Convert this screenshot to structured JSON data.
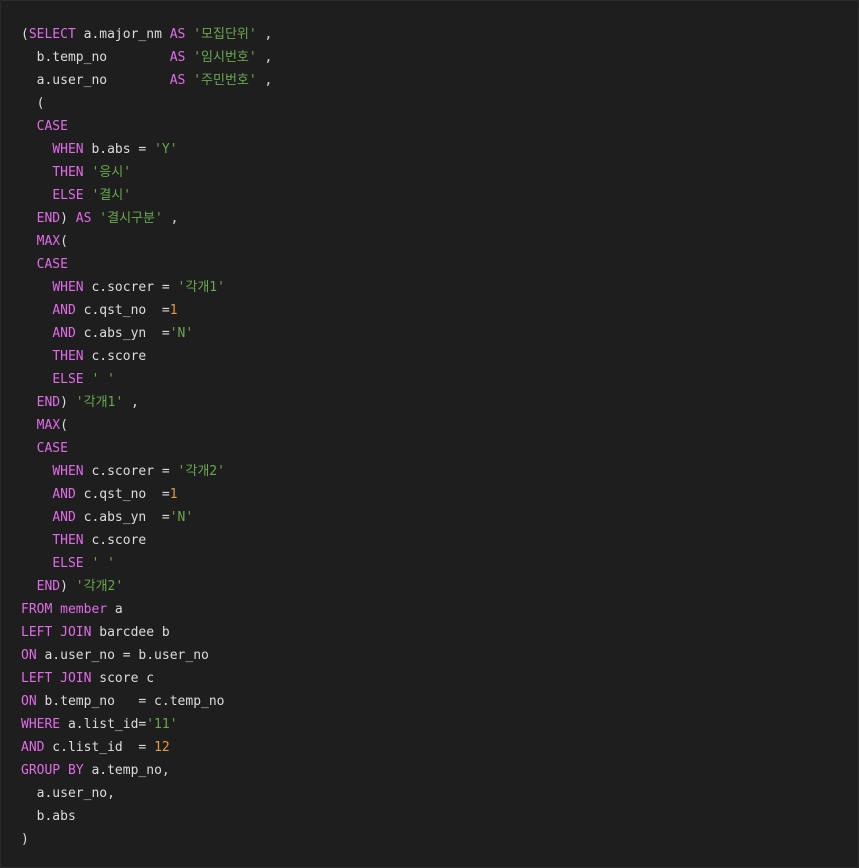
{
  "editor": {
    "language": "sql",
    "colors": {
      "background": "#1e1e1e",
      "keyword": "#e06ce8",
      "string": "#6aa84f",
      "number": "#e59b3f",
      "text": "#dcdcdc"
    },
    "lines": [
      [
        {
          "t": "pun",
          "v": "("
        },
        {
          "t": "kw",
          "v": "SELECT"
        },
        {
          "t": "id",
          "v": " a.major_nm "
        },
        {
          "t": "kw",
          "v": "AS"
        },
        {
          "t": "id",
          "v": " "
        },
        {
          "t": "str",
          "v": "'모집단위'"
        },
        {
          "t": "pun",
          "v": " ,"
        }
      ],
      [
        {
          "t": "id",
          "v": "  b.temp_no        "
        },
        {
          "t": "kw",
          "v": "AS"
        },
        {
          "t": "id",
          "v": " "
        },
        {
          "t": "str",
          "v": "'임시번호'"
        },
        {
          "t": "pun",
          "v": " ,"
        }
      ],
      [
        {
          "t": "id",
          "v": "  a.user_no        "
        },
        {
          "t": "kw",
          "v": "AS"
        },
        {
          "t": "id",
          "v": " "
        },
        {
          "t": "str",
          "v": "'주민번호'"
        },
        {
          "t": "pun",
          "v": " ,"
        }
      ],
      [
        {
          "t": "pun",
          "v": "  ("
        }
      ],
      [
        {
          "t": "id",
          "v": "  "
        },
        {
          "t": "kw",
          "v": "CASE"
        }
      ],
      [
        {
          "t": "id",
          "v": "    "
        },
        {
          "t": "kw",
          "v": "WHEN"
        },
        {
          "t": "id",
          "v": " b.abs = "
        },
        {
          "t": "str",
          "v": "'Y'"
        }
      ],
      [
        {
          "t": "id",
          "v": "    "
        },
        {
          "t": "kw",
          "v": "THEN"
        },
        {
          "t": "id",
          "v": " "
        },
        {
          "t": "str",
          "v": "'응시'"
        }
      ],
      [
        {
          "t": "id",
          "v": "    "
        },
        {
          "t": "kw",
          "v": "ELSE"
        },
        {
          "t": "id",
          "v": " "
        },
        {
          "t": "str",
          "v": "'결시'"
        }
      ],
      [
        {
          "t": "id",
          "v": "  "
        },
        {
          "t": "kw",
          "v": "END"
        },
        {
          "t": "pun",
          "v": ") "
        },
        {
          "t": "kw",
          "v": "AS"
        },
        {
          "t": "id",
          "v": " "
        },
        {
          "t": "str",
          "v": "'결시구분'"
        },
        {
          "t": "pun",
          "v": " ,"
        }
      ],
      [
        {
          "t": "id",
          "v": "  "
        },
        {
          "t": "kw",
          "v": "MAX"
        },
        {
          "t": "pun",
          "v": "("
        }
      ],
      [
        {
          "t": "id",
          "v": "  "
        },
        {
          "t": "kw",
          "v": "CASE"
        }
      ],
      [
        {
          "t": "id",
          "v": "    "
        },
        {
          "t": "kw",
          "v": "WHEN"
        },
        {
          "t": "id",
          "v": " c.socrer = "
        },
        {
          "t": "str",
          "v": "'각개1'"
        }
      ],
      [
        {
          "t": "id",
          "v": "    "
        },
        {
          "t": "kw",
          "v": "AND"
        },
        {
          "t": "id",
          "v": " c.qst_no  ="
        },
        {
          "t": "num",
          "v": "1"
        }
      ],
      [
        {
          "t": "id",
          "v": "    "
        },
        {
          "t": "kw",
          "v": "AND"
        },
        {
          "t": "id",
          "v": " c.abs_yn  ="
        },
        {
          "t": "str",
          "v": "'N'"
        }
      ],
      [
        {
          "t": "id",
          "v": "    "
        },
        {
          "t": "kw",
          "v": "THEN"
        },
        {
          "t": "id",
          "v": " c.score"
        }
      ],
      [
        {
          "t": "id",
          "v": "    "
        },
        {
          "t": "kw",
          "v": "ELSE"
        },
        {
          "t": "id",
          "v": " "
        },
        {
          "t": "str",
          "v": "' '"
        }
      ],
      [
        {
          "t": "id",
          "v": "  "
        },
        {
          "t": "kw",
          "v": "END"
        },
        {
          "t": "pun",
          "v": ") "
        },
        {
          "t": "str",
          "v": "'각개1'"
        },
        {
          "t": "pun",
          "v": " ,"
        }
      ],
      [
        {
          "t": "id",
          "v": "  "
        },
        {
          "t": "kw",
          "v": "MAX"
        },
        {
          "t": "pun",
          "v": "("
        }
      ],
      [
        {
          "t": "id",
          "v": "  "
        },
        {
          "t": "kw",
          "v": "CASE"
        }
      ],
      [
        {
          "t": "id",
          "v": "    "
        },
        {
          "t": "kw",
          "v": "WHEN"
        },
        {
          "t": "id",
          "v": " c.scorer = "
        },
        {
          "t": "str",
          "v": "'각개2'"
        }
      ],
      [
        {
          "t": "id",
          "v": "    "
        },
        {
          "t": "kw",
          "v": "AND"
        },
        {
          "t": "id",
          "v": " c.qst_no  ="
        },
        {
          "t": "num",
          "v": "1"
        }
      ],
      [
        {
          "t": "id",
          "v": "    "
        },
        {
          "t": "kw",
          "v": "AND"
        },
        {
          "t": "id",
          "v": " c.abs_yn  ="
        },
        {
          "t": "str",
          "v": "'N'"
        }
      ],
      [
        {
          "t": "id",
          "v": "    "
        },
        {
          "t": "kw",
          "v": "THEN"
        },
        {
          "t": "id",
          "v": " c.score"
        }
      ],
      [
        {
          "t": "id",
          "v": "    "
        },
        {
          "t": "kw",
          "v": "ELSE"
        },
        {
          "t": "id",
          "v": " "
        },
        {
          "t": "str",
          "v": "' '"
        }
      ],
      [
        {
          "t": "id",
          "v": "  "
        },
        {
          "t": "kw",
          "v": "END"
        },
        {
          "t": "pun",
          "v": ") "
        },
        {
          "t": "str",
          "v": "'각개2'"
        }
      ],
      [
        {
          "t": "kw",
          "v": "FROM"
        },
        {
          "t": "id",
          "v": " "
        },
        {
          "t": "kw",
          "v": "member"
        },
        {
          "t": "id",
          "v": " a"
        }
      ],
      [
        {
          "t": "kw",
          "v": "LEFT JOIN"
        },
        {
          "t": "id",
          "v": " barcdee b"
        }
      ],
      [
        {
          "t": "kw",
          "v": "ON"
        },
        {
          "t": "id",
          "v": " a.user_no = b.user_no"
        }
      ],
      [
        {
          "t": "kw",
          "v": "LEFT JOIN"
        },
        {
          "t": "id",
          "v": " score c"
        }
      ],
      [
        {
          "t": "kw",
          "v": "ON"
        },
        {
          "t": "id",
          "v": " b.temp_no   = c.temp_no"
        }
      ],
      [
        {
          "t": "kw",
          "v": "WHERE"
        },
        {
          "t": "id",
          "v": " a.list_id="
        },
        {
          "t": "str",
          "v": "'11'"
        }
      ],
      [
        {
          "t": "kw",
          "v": "AND"
        },
        {
          "t": "id",
          "v": " c.list_id  = "
        },
        {
          "t": "num",
          "v": "12"
        }
      ],
      [
        {
          "t": "kw",
          "v": "GROUP BY"
        },
        {
          "t": "id",
          "v": " a.temp_no,"
        }
      ],
      [
        {
          "t": "id",
          "v": "  a.user_no,"
        }
      ],
      [
        {
          "t": "id",
          "v": "  b.abs"
        }
      ],
      [
        {
          "t": "pun",
          "v": ")"
        }
      ]
    ]
  }
}
